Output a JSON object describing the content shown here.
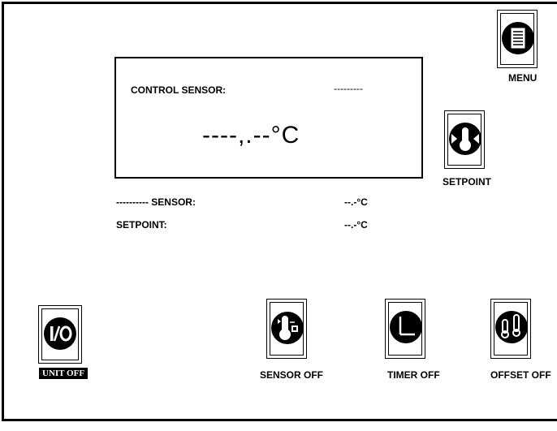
{
  "display": {
    "control_sensor_label": "CONTROL SENSOR:",
    "control_sensor_value": "---------",
    "main_temperature": "----,.--°C"
  },
  "readings": {
    "sensor_label": "---------- SENSOR:",
    "sensor_value": "--.-°C",
    "setpoint_label": "SETPOINT:",
    "setpoint_value": "--.-°C"
  },
  "buttons": {
    "menu": "MENU",
    "setpoint": "SETPOINT",
    "unit": "UNIT OFF",
    "sensor": "SENSOR OFF",
    "timer": "TIMER OFF",
    "offset": "OFFSET OFF"
  }
}
